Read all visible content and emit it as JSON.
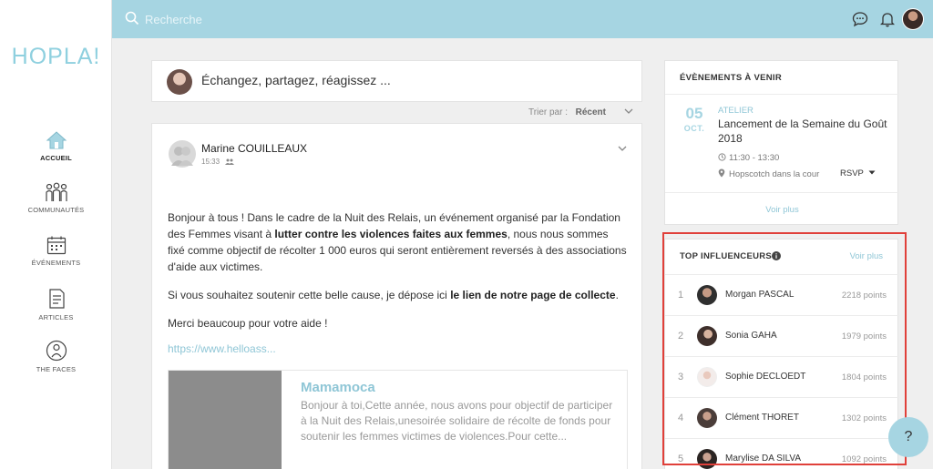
{
  "app": {
    "logo": "HOPLA!"
  },
  "search": {
    "placeholder": "Recherche"
  },
  "sidebar": {
    "items": [
      {
        "label": "ACCUEIL",
        "icon": "home-icon"
      },
      {
        "label": "COMMUNAUTÉS",
        "icon": "community-icon"
      },
      {
        "label": "ÉVÉNEMENTS",
        "icon": "calendar-icon"
      },
      {
        "label": "ARTICLES",
        "icon": "article-icon"
      },
      {
        "label": "THE FACES",
        "icon": "person-icon"
      }
    ]
  },
  "compose": {
    "placeholder": "Échangez, partagez, réagissez ..."
  },
  "sort": {
    "label": "Trier par :",
    "value": "Récent"
  },
  "post": {
    "author": "Marine COUILLEAUX",
    "time": "15:33",
    "p1_a": "Bonjour à tous ! Dans le cadre de la Nuit des Relais, un événement organisé par la Fondation des Femmes visant à ",
    "p1_bold": "lutter contre les violences faites aux femmes",
    "p1_b": ", nous nous sommes fixé comme objectif de récolter 1 000 euros qui seront entièrement reversés à des associations d'aide aux victimes.",
    "p2_a": "Si vous souhaitez soutenir cette belle cause, je dépose ici ",
    "p2_bold": "le lien de notre page de collecte",
    "p2_b": ".",
    "p3": "Merci beaucoup pour votre aide !",
    "link": "https://www.helloass...",
    "preview": {
      "title": "Mamamoca",
      "description": "Bonjour à toi,Cette année, nous avons pour objectif de participer à la Nuit des Relais,unesoirée solidaire de récolte de fonds pour soutenir les femmes victimes de violences.Pour cette..."
    }
  },
  "events": {
    "title": "ÉVÈNEMENTS À VENIR",
    "item": {
      "day": "05",
      "month": "OCT.",
      "category": "ATELIER",
      "title": "Lancement de la Semaine du Goût 2018",
      "time": "11:30 - 13:30",
      "place": "Hopscotch dans la cour",
      "rsvp": "RSVP"
    },
    "more": "Voir plus"
  },
  "influencers": {
    "title": "TOP INFLUENCEURS",
    "more": "Voir plus",
    "rows": [
      {
        "rank": "1",
        "name": "Morgan PASCAL",
        "points": "2218 points",
        "avatar_color": "#3b3b3b"
      },
      {
        "rank": "2",
        "name": "Sonia GAHA",
        "points": "1979 points",
        "avatar_color": "#4a3a35"
      },
      {
        "rank": "3",
        "name": "Sophie DECLOEDT",
        "points": "1804 points",
        "avatar_color": "#d9b8b3"
      },
      {
        "rank": "4",
        "name": "Clément THORET",
        "points": "1302 points",
        "avatar_color": "#5a4a45"
      },
      {
        "rank": "5",
        "name": "Marylise DA SILVA",
        "points": "1092 points",
        "avatar_color": "#2f2a28"
      }
    ]
  },
  "help": {
    "label": "?"
  },
  "colors": {
    "accent": "#a6d5e2",
    "link": "#8fc6d6",
    "highlight": "#e0403a"
  }
}
